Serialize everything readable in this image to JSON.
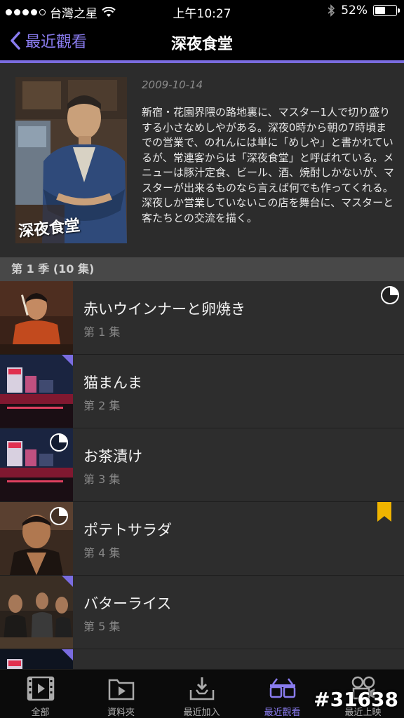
{
  "status_bar": {
    "carrier": "台灣之星",
    "time": "上午10:27",
    "battery": "52%",
    "battery_level": 0.52
  },
  "nav": {
    "back_label": "最近觀看",
    "title": "深夜食堂"
  },
  "show": {
    "poster_caption": "深夜食堂",
    "air_date": "2009-10-14",
    "description": "新宿・花園界隈の路地裏に、マスター1人で切り盛りする小さなめしやがある。深夜0時から朝の7時頃までの営業で、のれんには単に「めしや」と書かれているが、常連客からは「深夜食堂」と呼ばれている。メニューは豚汁定食、ビール、酒、焼酎しかないが、マスターが出来るものなら言えば何でも作ってくれる。深夜しか営業していないこの店を舞台に、マスターと客たちとの交流を描く。"
  },
  "season": {
    "header": "第 1 季 (10 集)"
  },
  "episodes": [
    {
      "title": "赤いウインナーと卵焼き",
      "number": "第 1 集",
      "progress_icon": "progress-pie-icon",
      "progress": 0.25
    },
    {
      "title": "猫まんま",
      "number": "第 2 集",
      "badge": "new-corner"
    },
    {
      "title": "お茶漬け",
      "number": "第 3 集",
      "progress_icon": "progress-pie-icon",
      "progress": 0.25
    },
    {
      "title": "ポテトサラダ",
      "number": "第 4 集",
      "progress_icon": "progress-pie-icon",
      "progress": 0.25,
      "bookmark": "bookmark-icon"
    },
    {
      "title": "バターライス",
      "number": "第 5 集",
      "badge": "new-corner"
    }
  ],
  "tabs": [
    {
      "label": "全部",
      "icon": "film-icon"
    },
    {
      "label": "資料夾",
      "icon": "folder-play-icon"
    },
    {
      "label": "最近加入",
      "icon": "tray-download-icon"
    },
    {
      "label": "最近觀看",
      "icon": "glasses-icon",
      "active": true
    },
    {
      "label": "最近上映",
      "icon": "film-reel-icon"
    }
  ],
  "watermark": "#31638",
  "colors": {
    "accent": "#7a6ce0",
    "bookmark": "#f0b400",
    "background": "#2a2a2a"
  }
}
